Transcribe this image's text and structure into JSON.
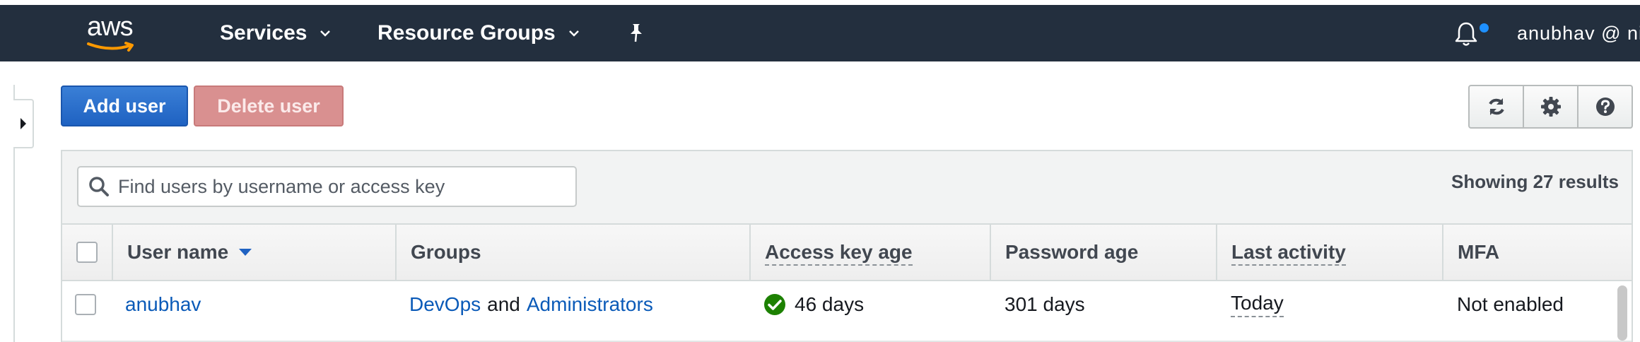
{
  "nav": {
    "logo_text": "aws",
    "services_label": "Services",
    "resource_groups_label": "Resource Groups",
    "pin_icon": "pushpin-icon",
    "bell_icon": "bell-icon",
    "account_label": "anubhav @ nir"
  },
  "actions": {
    "add_user_label": "Add user",
    "delete_user_label": "Delete user",
    "refresh_icon": "refresh-icon",
    "settings_icon": "gear-icon",
    "help_icon": "help-icon"
  },
  "search": {
    "placeholder": "Find users by username or access key",
    "value": ""
  },
  "results_text": "Showing 27 results",
  "table": {
    "columns": [
      "User name",
      "Groups",
      "Access key age",
      "Password age",
      "Last activity",
      "MFA"
    ],
    "rows": [
      {
        "user_name": "anubhav",
        "group_1": "DevOps",
        "group_join": "and",
        "group_2": "Administrators",
        "access_key_age": "46 days",
        "password_age": "301 days",
        "last_activity": "Today",
        "mfa": "Not enabled"
      }
    ]
  },
  "colors": {
    "nav_bg": "#232f3e",
    "primary_button": "#2a6fcf",
    "disabled_danger_button": "#d99090",
    "link": "#0a5ab8",
    "status_ok": "#1d8102"
  }
}
